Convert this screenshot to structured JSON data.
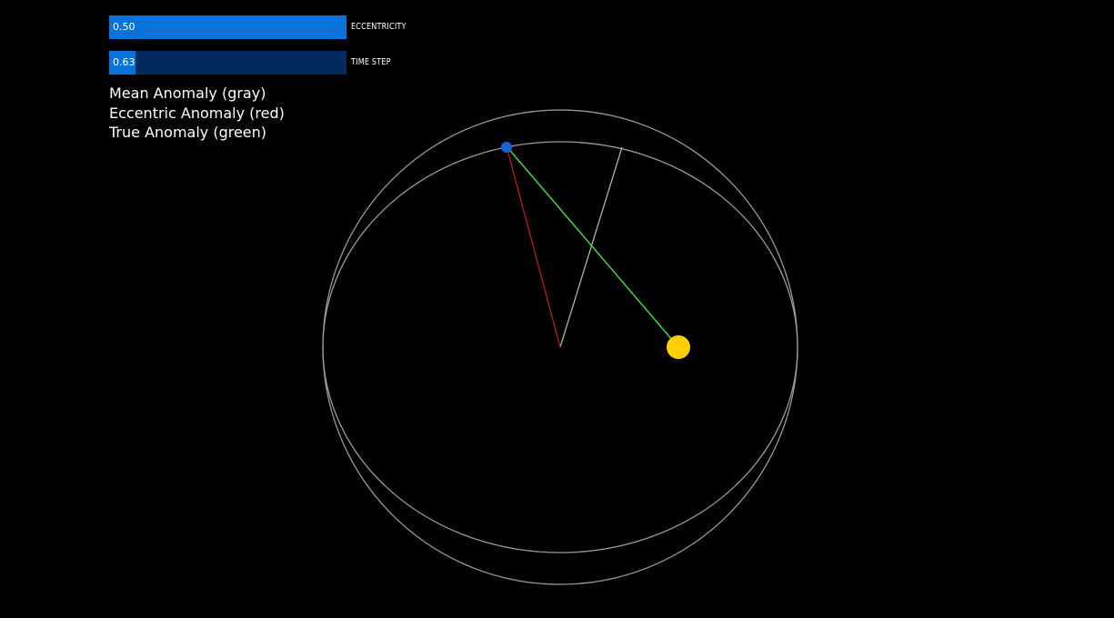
{
  "sliders": {
    "eccentricity": {
      "label": "ECCENTRICITY",
      "value_text": "0.50",
      "fraction": 1.0,
      "track_color": "#002B5E",
      "fill_color": "#0A73D9"
    },
    "time_step": {
      "label": "TIME STEP",
      "value_text": "0.63",
      "fraction": 0.11,
      "track_color": "#002B5E",
      "fill_color": "#0A73D9"
    }
  },
  "legend": {
    "mean": "Mean Anomaly (gray)",
    "eccentric": "Eccentric Anomaly (red)",
    "true": "True Anomaly (green)"
  },
  "colors": {
    "background": "#000000",
    "orbit_lines": "#9a9a9a",
    "mean_line": "#b0b0b0",
    "eccentric_line": "#c0161a",
    "true_line": "#3ee03e",
    "sun": "#ffcf00",
    "planet": "#1a63d6"
  }
}
